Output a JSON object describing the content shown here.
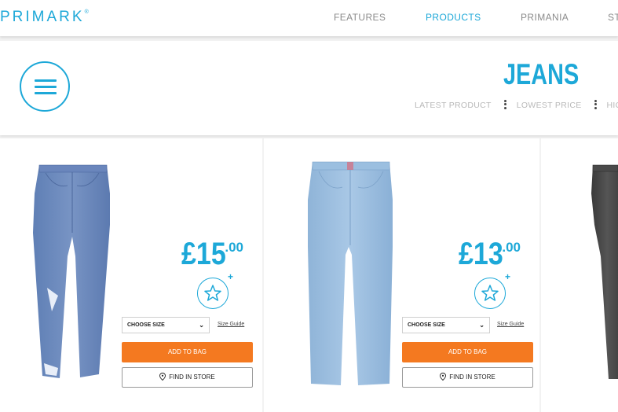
{
  "brand": {
    "logo_text": "PRIMARK",
    "logo_mark": "®"
  },
  "nav": {
    "items": [
      {
        "label": "FEATURES",
        "active": false
      },
      {
        "label": "PRODUCTS",
        "active": true
      },
      {
        "label": "PRIMANIA",
        "active": false
      },
      {
        "label": "ST",
        "active": false
      }
    ]
  },
  "category": {
    "title": "JEANS",
    "sort_options": [
      "LATEST PRODUCT",
      "LOWEST PRICE",
      "HIG"
    ]
  },
  "products": [
    {
      "price_main": "£15",
      "price_cents": ".00",
      "size_placeholder": "CHOOSE SIZE",
      "size_guide": "Size Guide",
      "add_to_bag": "ADD TO BAG",
      "find_in_store": "FIND IN STORE",
      "wash": "mid-blue"
    },
    {
      "price_main": "£13",
      "price_cents": ".00",
      "size_placeholder": "CHOOSE SIZE",
      "size_guide": "Size Guide",
      "add_to_bag": "ADD TO BAG",
      "find_in_store": "FIND IN STORE",
      "wash": "light-blue"
    },
    {
      "wash": "black-acid"
    }
  ],
  "colors": {
    "accent": "#1da8d8",
    "cta": "#f47920",
    "background": "#f2f2f2"
  }
}
